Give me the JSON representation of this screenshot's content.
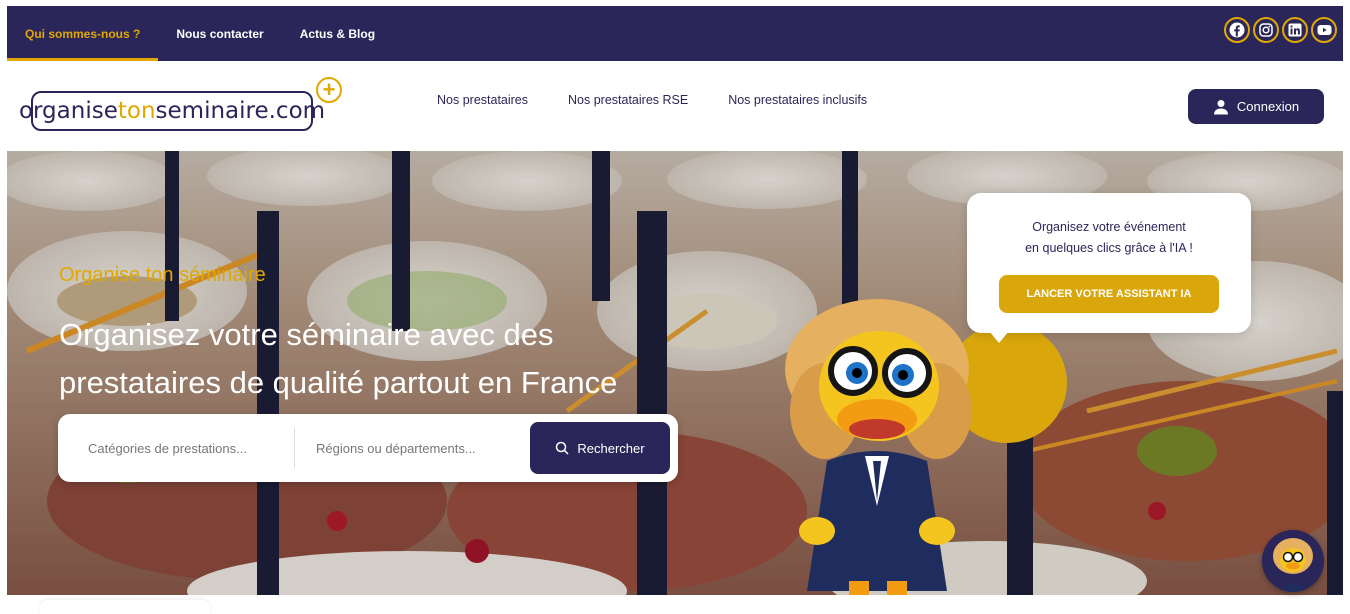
{
  "topbar": {
    "nav": [
      {
        "label": "Qui sommes-nous ?",
        "active": true
      },
      {
        "label": "Nous contacter",
        "active": false
      },
      {
        "label": "Actus & Blog",
        "active": false
      }
    ],
    "socials": [
      "facebook-icon",
      "instagram-icon",
      "linkedin-icon",
      "youtube-icon"
    ],
    "accent": "#e0a800",
    "background": "#2b2659"
  },
  "header": {
    "logo": {
      "part_a": "organise",
      "part_b": "ton",
      "part_c": "seminaire.com"
    },
    "nav": [
      "Nos prestataires",
      "Nos prestataires RSE",
      "Nos prestataires inclusifs"
    ],
    "login_label": "Connexion"
  },
  "hero": {
    "kicker": "Organise ton séminaire",
    "title": "Organisez votre séminaire avec des prestataires de qualité partout en France",
    "search": {
      "category_placeholder": "Catégories de prestations...",
      "region_placeholder": "Régions ou départements...",
      "button_label": "Rechercher"
    },
    "ai_card": {
      "line1": "Organisez votre événement",
      "line2": "en quelques clics grâce à l'IA !",
      "button_label": "LANCER VOTRE ASSISTANT IA"
    }
  }
}
